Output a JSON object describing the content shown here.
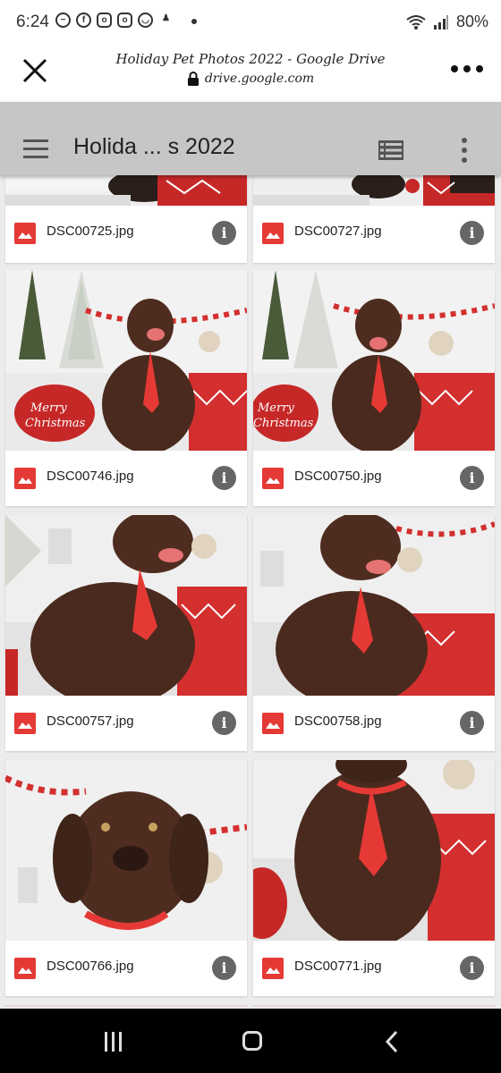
{
  "status_bar": {
    "time": "6:24",
    "battery": "80%",
    "notification_icons": [
      "minus-circle-icon",
      "facebook-icon",
      "instagram-icon",
      "instagram-icon",
      "cooking-icon",
      "meditation-icon"
    ]
  },
  "browser": {
    "page_title": "Holiday Pet Photos 2022 - Google Drive",
    "url": "drive.google.com"
  },
  "toolbar": {
    "folder_title": "Holida ... s 2022"
  },
  "files": [
    {
      "name": "DSC00725.jpg"
    },
    {
      "name": "DSC00727.jpg"
    },
    {
      "name": "DSC00746.jpg"
    },
    {
      "name": "DSC00750.jpg"
    },
    {
      "name": "DSC00757.jpg"
    },
    {
      "name": "DSC00758.jpg"
    },
    {
      "name": "DSC00766.jpg"
    },
    {
      "name": "DSC00771.jpg"
    }
  ],
  "colors": {
    "image_file_icon": "#e53935",
    "toolbar_bg": "#c6c6c6",
    "grid_bg": "#ececec"
  }
}
